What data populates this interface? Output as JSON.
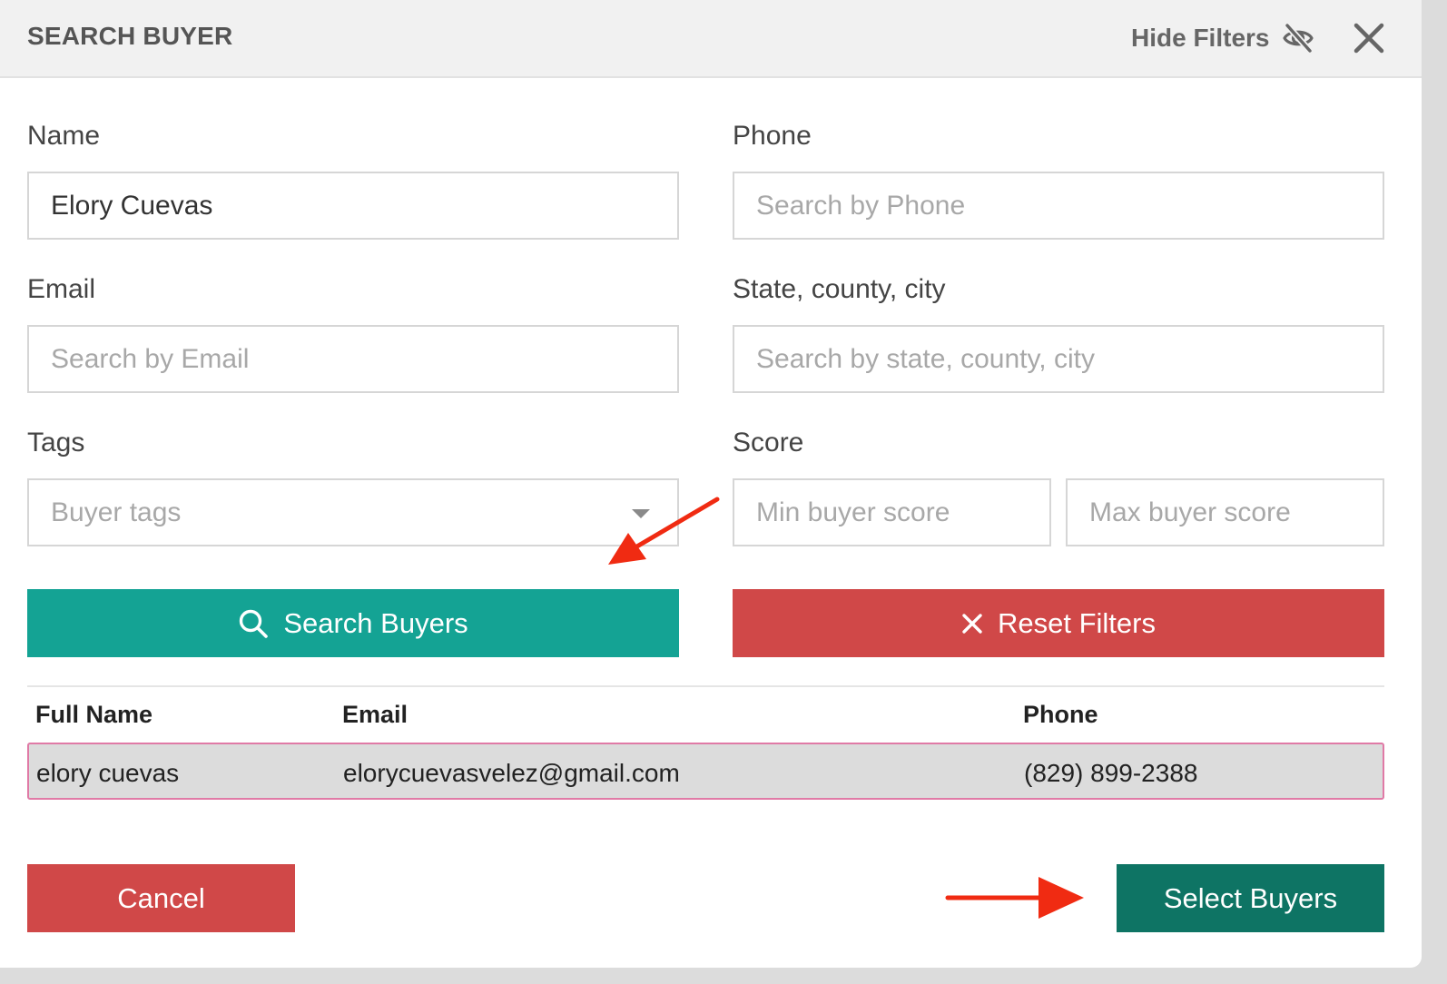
{
  "header": {
    "title": "SEARCH BUYER",
    "hide_filters_label": "Hide Filters",
    "hide_icon": "eye-slash-icon",
    "close_icon": "close-icon"
  },
  "filters": {
    "name": {
      "label": "Name",
      "value": "Elory Cuevas",
      "placeholder": ""
    },
    "phone": {
      "label": "Phone",
      "value": "",
      "placeholder": "Search by Phone"
    },
    "email": {
      "label": "Email",
      "value": "",
      "placeholder": "Search by Email"
    },
    "location": {
      "label": "State, county, city",
      "value": "",
      "placeholder": "Search by state, county, city"
    },
    "tags": {
      "label": "Tags",
      "value": "",
      "placeholder": "Buyer tags"
    },
    "score": {
      "label": "Score",
      "min_placeholder": "Min buyer score",
      "max_placeholder": "Max buyer score"
    }
  },
  "actions": {
    "search_label": "Search Buyers",
    "search_icon": "search-icon",
    "reset_label": "Reset Filters",
    "reset_icon": "x-icon",
    "cancel_label": "Cancel",
    "select_label": "Select Buyers"
  },
  "results": {
    "columns": [
      "Full Name",
      "Email",
      "Phone"
    ],
    "rows": [
      {
        "full_name": "elory cuevas",
        "email": "elorycuevasvelez@gmail.com",
        "phone": "(829) 899-2388"
      }
    ]
  },
  "colors": {
    "search_button": "#14a394",
    "reset_button": "#d04848",
    "cancel_button": "#d04848",
    "select_button": "#0e7464",
    "selected_row_border": "#e07aa6",
    "annotation_arrow": "#f02b12"
  }
}
